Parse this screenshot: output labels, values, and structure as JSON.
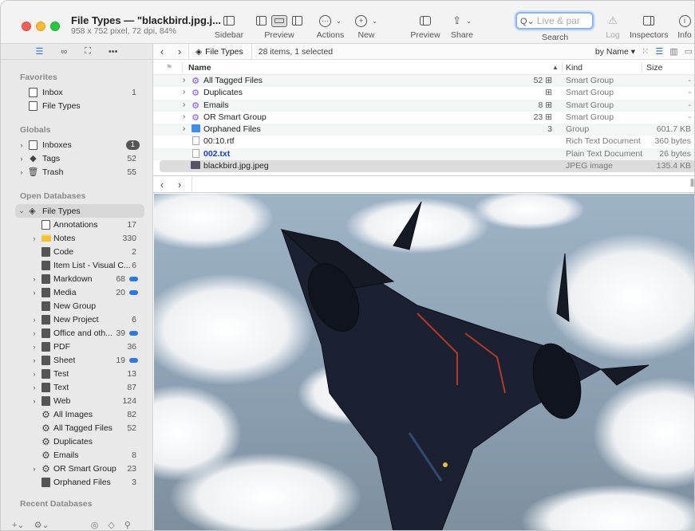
{
  "window": {
    "title": "File Types — \"blackbird.jpg.j...",
    "subtitle": "958 x 752 pixel, 72 dpi, 84%"
  },
  "toolbar": {
    "sidebar": "Sidebar",
    "preview": "Preview",
    "actions": "Actions",
    "new": "New",
    "preview2": "Preview",
    "share": "Share",
    "search_placeholder": "Live & par",
    "search": "Search",
    "log": "Log",
    "inspectors": "Inspectors",
    "info": "Info"
  },
  "sidebar": {
    "favorites_title": "Favorites",
    "favorites": [
      {
        "label": "Inbox",
        "count": "1"
      },
      {
        "label": "File Types",
        "count": ""
      }
    ],
    "globals_title": "Globals",
    "globals": [
      {
        "label": "Inboxes",
        "count": "1"
      },
      {
        "label": "Tags",
        "count": "52"
      },
      {
        "label": "Trash",
        "count": "55"
      }
    ],
    "open_title": "Open Databases",
    "db_name": "File Types",
    "items": [
      {
        "label": "Annotations",
        "count": "17"
      },
      {
        "label": "Notes",
        "count": "330"
      },
      {
        "label": "Code",
        "count": "2"
      },
      {
        "label": "Item List - Visual C...",
        "count": "6"
      },
      {
        "label": "Markdown",
        "count": "68"
      },
      {
        "label": "Media",
        "count": "20"
      },
      {
        "label": "New Group",
        "count": ""
      },
      {
        "label": "New Project",
        "count": "6"
      },
      {
        "label": "Office and oth...",
        "count": "39"
      },
      {
        "label": "PDF",
        "count": "36"
      },
      {
        "label": "Sheet",
        "count": "19"
      },
      {
        "label": "Test",
        "count": "13"
      },
      {
        "label": "Text",
        "count": "87"
      },
      {
        "label": "Web",
        "count": "124"
      },
      {
        "label": "All Images",
        "count": "82"
      },
      {
        "label": "All Tagged Files",
        "count": "52"
      },
      {
        "label": "Duplicates",
        "count": ""
      },
      {
        "label": "Emails",
        "count": "8"
      },
      {
        "label": "OR Smart Group",
        "count": "23"
      },
      {
        "label": "Orphaned Files",
        "count": "3"
      }
    ],
    "recent_title": "Recent Databases"
  },
  "pathbar": {
    "crumb": "File Types",
    "status": "28 items, 1 selected",
    "sort": "by Name"
  },
  "list": {
    "columns": {
      "name": "Name",
      "kind": "Kind",
      "size": "Size"
    },
    "rows": [
      {
        "name": "All Tagged Files",
        "count": "52",
        "kind": "Smart Group",
        "size": "-"
      },
      {
        "name": "Duplicates",
        "count": "",
        "kind": "Smart Group",
        "size": "-"
      },
      {
        "name": "Emails",
        "count": "8",
        "kind": "Smart Group",
        "size": "-"
      },
      {
        "name": "OR Smart Group",
        "count": "23",
        "kind": "Smart Group",
        "size": "-"
      },
      {
        "name": "Orphaned Files",
        "count": "3",
        "kind": "Group",
        "size": "601.7 KB"
      },
      {
        "name": "00:10.rtf",
        "count": "",
        "kind": "Rich Text Document",
        "size": "360 bytes"
      },
      {
        "name": "002.txt",
        "count": "",
        "kind": "Plain Text Document",
        "size": "26 bytes"
      },
      {
        "name": "blackbird.jpg.jpeg",
        "count": "",
        "kind": "JPEG image",
        "size": "135.4 KB"
      }
    ]
  },
  "colors": {
    "accent": "#2d6fe6",
    "sidebar_bg": "#e9e9e9",
    "selection": "#dcdcdc",
    "smart_group": "#8b56d6",
    "badge": "#2d78e8"
  }
}
